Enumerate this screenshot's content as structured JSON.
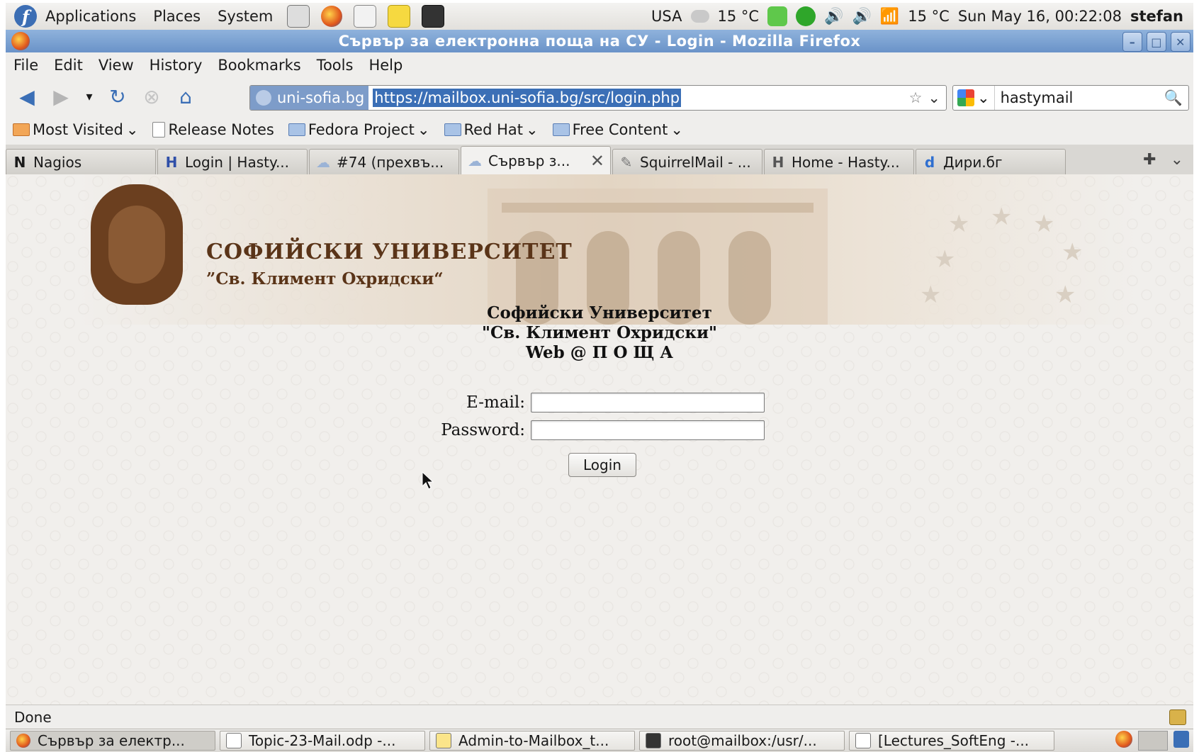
{
  "panel": {
    "menus": [
      "Applications",
      "Places",
      "System"
    ],
    "launchers": [
      "system-monitor-icon",
      "firefox-icon",
      "mail-icon",
      "notes-icon",
      "terminal-icon"
    ],
    "keyboard_layout": "USA",
    "weather_left": "15 °C",
    "weather_right": "15 °C",
    "clock": "Sun May 16, 00:22:08",
    "user": "stefan"
  },
  "window": {
    "title": "Сървър за електронна поща на СУ - Login - Mozilla Firefox"
  },
  "menubar": {
    "items": [
      "File",
      "Edit",
      "View",
      "History",
      "Bookmarks",
      "Tools",
      "Help"
    ]
  },
  "navbar": {
    "site_identity": "uni-sofia.bg",
    "url": "https://mailbox.uni-sofia.bg/src/login.php",
    "search_value": "hastymail"
  },
  "bookmarks": {
    "items": [
      "Most Visited",
      "Release Notes",
      "Fedora Project",
      "Red Hat",
      "Free Content"
    ]
  },
  "tabs": [
    {
      "icon": "N",
      "label": "Nagios"
    },
    {
      "icon": "H",
      "label": "Login | Hasty..."
    },
    {
      "icon": "☁",
      "label": "#74 (прехвъ..."
    },
    {
      "icon": "☁",
      "label": "Сървър з...",
      "active": true
    },
    {
      "icon": "✎",
      "label": "SquirrelMail - ..."
    },
    {
      "icon": "H",
      "label": "Home - Hasty..."
    },
    {
      "icon": "d",
      "label": "Дири.бг"
    }
  ],
  "page": {
    "banner_name": "СОФИЙСКИ УНИВЕРСИТЕТ",
    "banner_sub": "”Св. Климент Охридски“",
    "heading_line1": "Софийски Университет",
    "heading_line2": "\"Св. Климент Охридски\"",
    "heading_line3": "Web @ П О Щ А",
    "email_label": "E-mail:",
    "email_value": "",
    "password_label": "Password:",
    "password_value": "",
    "login_button": "Login"
  },
  "status": {
    "text": "Done"
  },
  "taskbar": {
    "tasks": [
      "Сървър за електр...",
      "Topic-23-Mail.odp -...",
      "Admin-to-Mailbox_t...",
      "root@mailbox:/usr/...",
      "[Lectures_SoftEng -..."
    ]
  },
  "colors": {
    "titlebar": "#7aa0d0",
    "url_highlight": "#3b6fb6",
    "banner_brown": "#5a3418"
  }
}
